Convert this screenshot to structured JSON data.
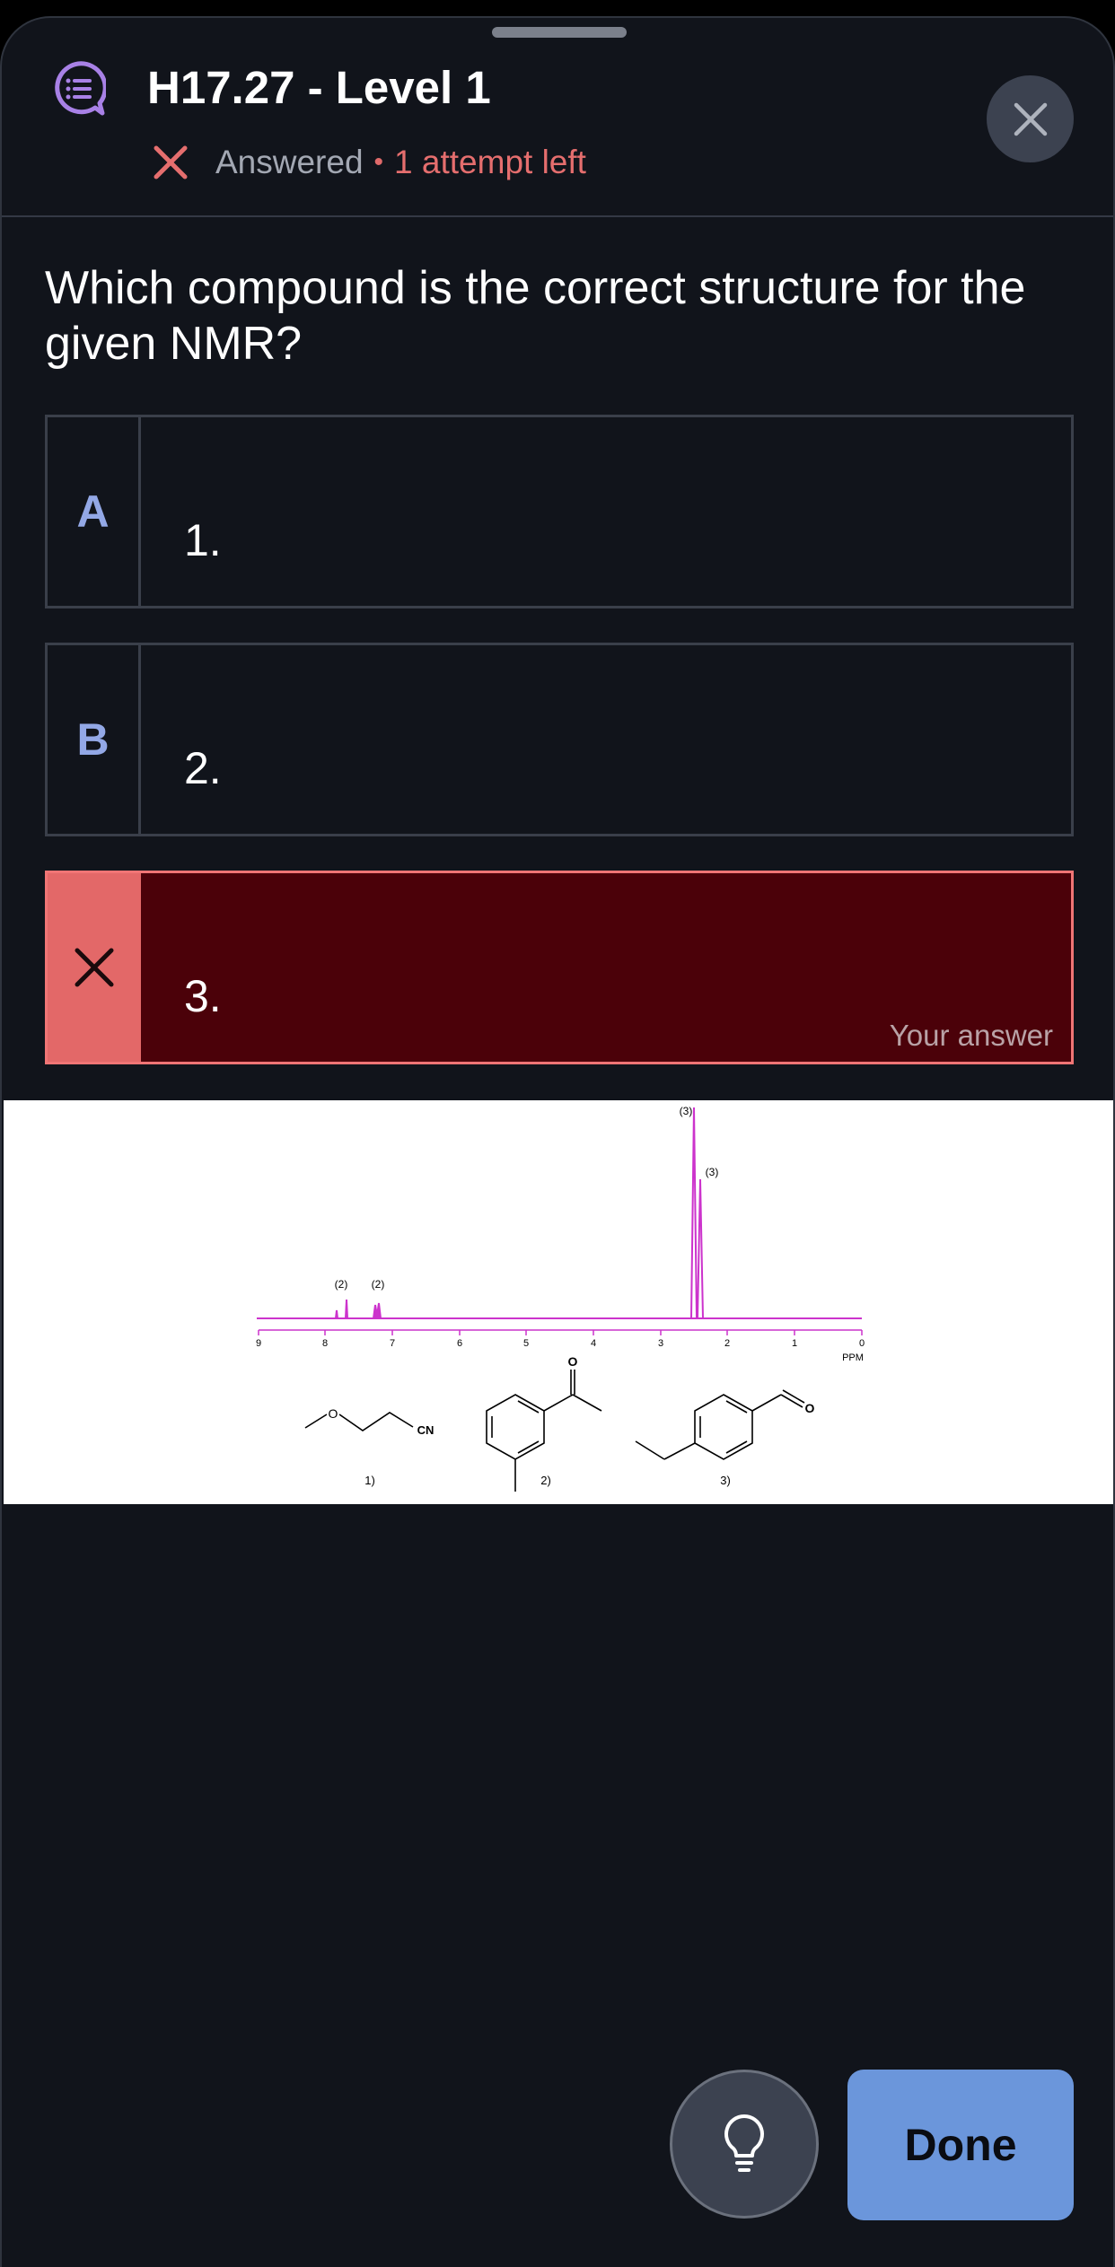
{
  "header": {
    "title": "H17.27 - Level 1",
    "status_answered": "Answered",
    "status_separator": "•",
    "status_attempts": "1 attempt left",
    "icons": {
      "quiz": "quiz-chat-icon",
      "status": "x-mark-icon",
      "close": "close-icon"
    }
  },
  "question": {
    "text": "Which compound is the correct structure for the given NMR?"
  },
  "options": [
    {
      "letter": "A",
      "text": "1.",
      "state": "default"
    },
    {
      "letter": "B",
      "text": "2.",
      "state": "default"
    },
    {
      "letter": "",
      "text": "3.",
      "state": "wrong",
      "badge": "Your answer"
    }
  ],
  "spectrum": {
    "x_axis_ticks": [
      "9",
      "8",
      "7",
      "6",
      "5",
      "4",
      "3",
      "2",
      "1",
      "0"
    ],
    "x_axis_unit": "PPM",
    "peak_labels": [
      "(2)",
      "(2)",
      "(3)",
      "(3)"
    ],
    "structure_labels": [
      "1)",
      "2)",
      "3)"
    ],
    "atom_labels": {
      "oxygen": "O",
      "nitrile": "CN"
    },
    "peak_color": "#cc33cc"
  },
  "footer": {
    "hint_icon": "lightbulb-icon",
    "done_label": "Done"
  },
  "colors": {
    "background": "#11141b",
    "accent": "#6b96db",
    "error": "#e36868",
    "error_fill": "#4b0109",
    "letter": "#93a8e6"
  }
}
